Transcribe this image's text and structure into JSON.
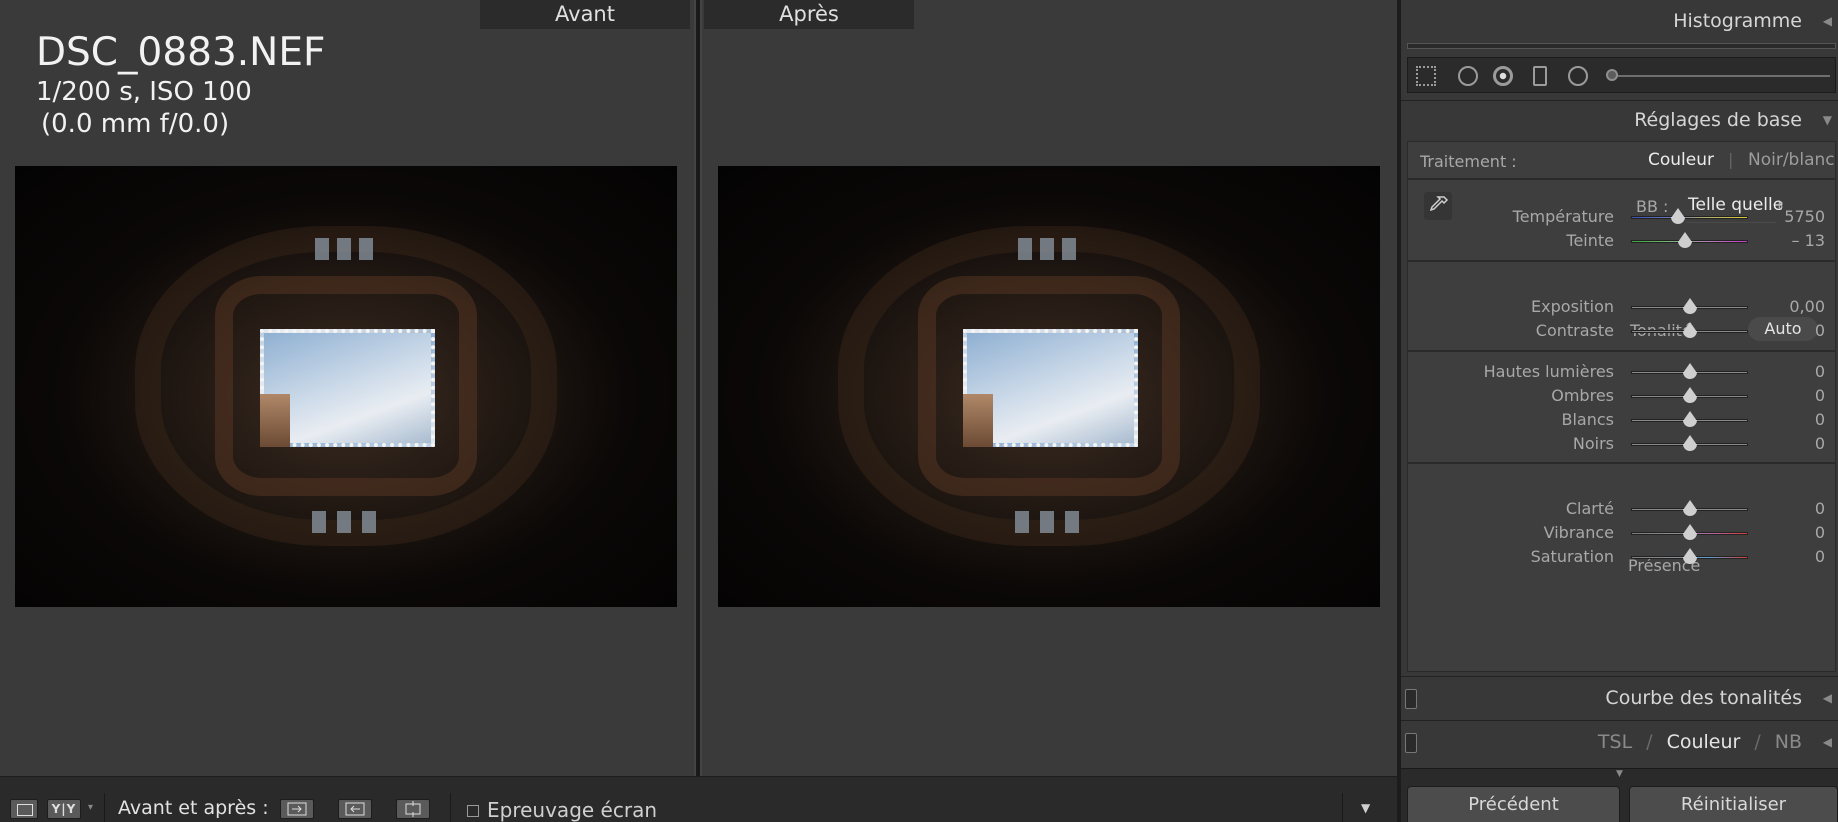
{
  "compare": {
    "before_label": "Avant",
    "after_label": "Après",
    "photo_info": {
      "filename": "DSC_0883.NEF",
      "exposure": "1/200 s, ISO 100",
      "lens": "(0.0 mm f/0.0)"
    }
  },
  "toolbar": {
    "view_yy_label": "Y|Y",
    "mode_label": "Avant et après :",
    "soft_proof_label": "Epreuvage écran"
  },
  "panel": {
    "histogram_title": "Histogramme",
    "basic": {
      "title": "Réglages de base",
      "treatment_label": "Traitement :",
      "treatment_color": "Couleur",
      "treatment_bw": "Noir/blanc",
      "wb_label": "BB :",
      "wb_value": "Telle quelle",
      "temperature": {
        "label": "Température",
        "value": "5750",
        "fraction": 0.4
      },
      "tint": {
        "label": "Teinte",
        "value": "– 13",
        "fraction": 0.46
      },
      "tone_title": "Tonalité",
      "auto_label": "Auto",
      "exposure": {
        "label": "Exposition",
        "value": "0,00",
        "fraction": 0.5
      },
      "contrast": {
        "label": "Contraste",
        "value": "0",
        "fraction": 0.5
      },
      "highlights": {
        "label": "Hautes lumières",
        "value": "0",
        "fraction": 0.5
      },
      "shadows": {
        "label": "Ombres",
        "value": "0",
        "fraction": 0.5
      },
      "whites": {
        "label": "Blancs",
        "value": "0",
        "fraction": 0.5
      },
      "blacks": {
        "label": "Noirs",
        "value": "0",
        "fraction": 0.5
      },
      "presence_title": "Présence",
      "clarity": {
        "label": "Clarté",
        "value": "0",
        "fraction": 0.5
      },
      "vibrance": {
        "label": "Vibrance",
        "value": "0",
        "fraction": 0.5
      },
      "saturation": {
        "label": "Saturation",
        "value": "0",
        "fraction": 0.5
      }
    },
    "tone_curve_title": "Courbe des tonalités",
    "hsl": {
      "tsl": "TSL",
      "color": "Couleur",
      "nb": "NB"
    },
    "previous_label": "Précédent",
    "reset_label": "Réinitialiser"
  }
}
